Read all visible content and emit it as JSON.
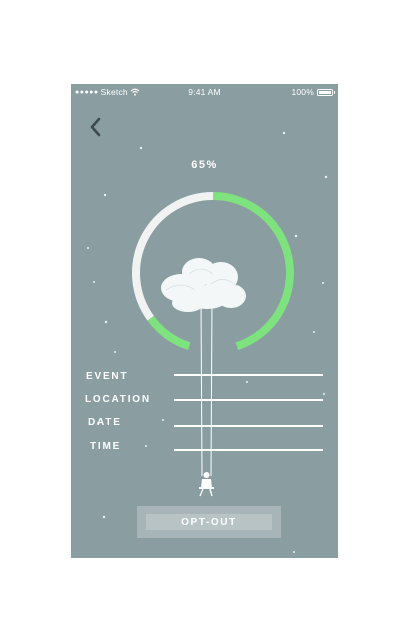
{
  "status_bar": {
    "carrier": "Sketch",
    "time": "9:41 AM",
    "battery": "100%"
  },
  "progress": {
    "label": "65%",
    "value": 0.65
  },
  "fields": [
    {
      "label": "EVENT"
    },
    {
      "label": "LOCATION"
    },
    {
      "label": "DATE"
    },
    {
      "label": "TIME"
    }
  ],
  "opt_out": {
    "label": "OPT-OUT"
  },
  "icons": {
    "back": "chevron-left-icon",
    "wifi": "wifi-icon",
    "battery": "battery-icon",
    "cloud": "cloud-icon",
    "swing": "swing-figure-icon"
  },
  "colors": {
    "background": "#8a9da1",
    "progress": "#7ee27e",
    "track": "#f1f3f3"
  }
}
